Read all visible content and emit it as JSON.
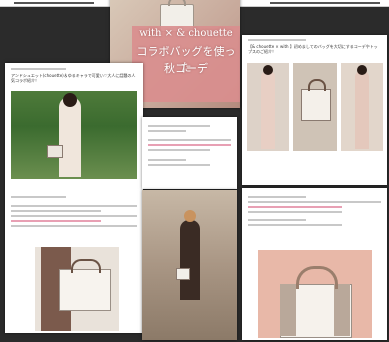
{
  "banner": {
    "line1": "with × & chouette",
    "line2": "コラボバッグを使った",
    "line3": "秋コーデ"
  },
  "article_left": {
    "title": "アンドシュエット(chouette)＆ゆるキャラで可愛い♡大人に話題の人気コラボ紹介！"
  },
  "article_right": {
    "title": "【& chouette × with 】初めましてのバッグを大切にするコーデやトップスのご紹介！"
  },
  "colors": {
    "background": "#2b2b2b",
    "banner_pink": "#d98e8e",
    "text_pink": "#e8a0b4"
  }
}
